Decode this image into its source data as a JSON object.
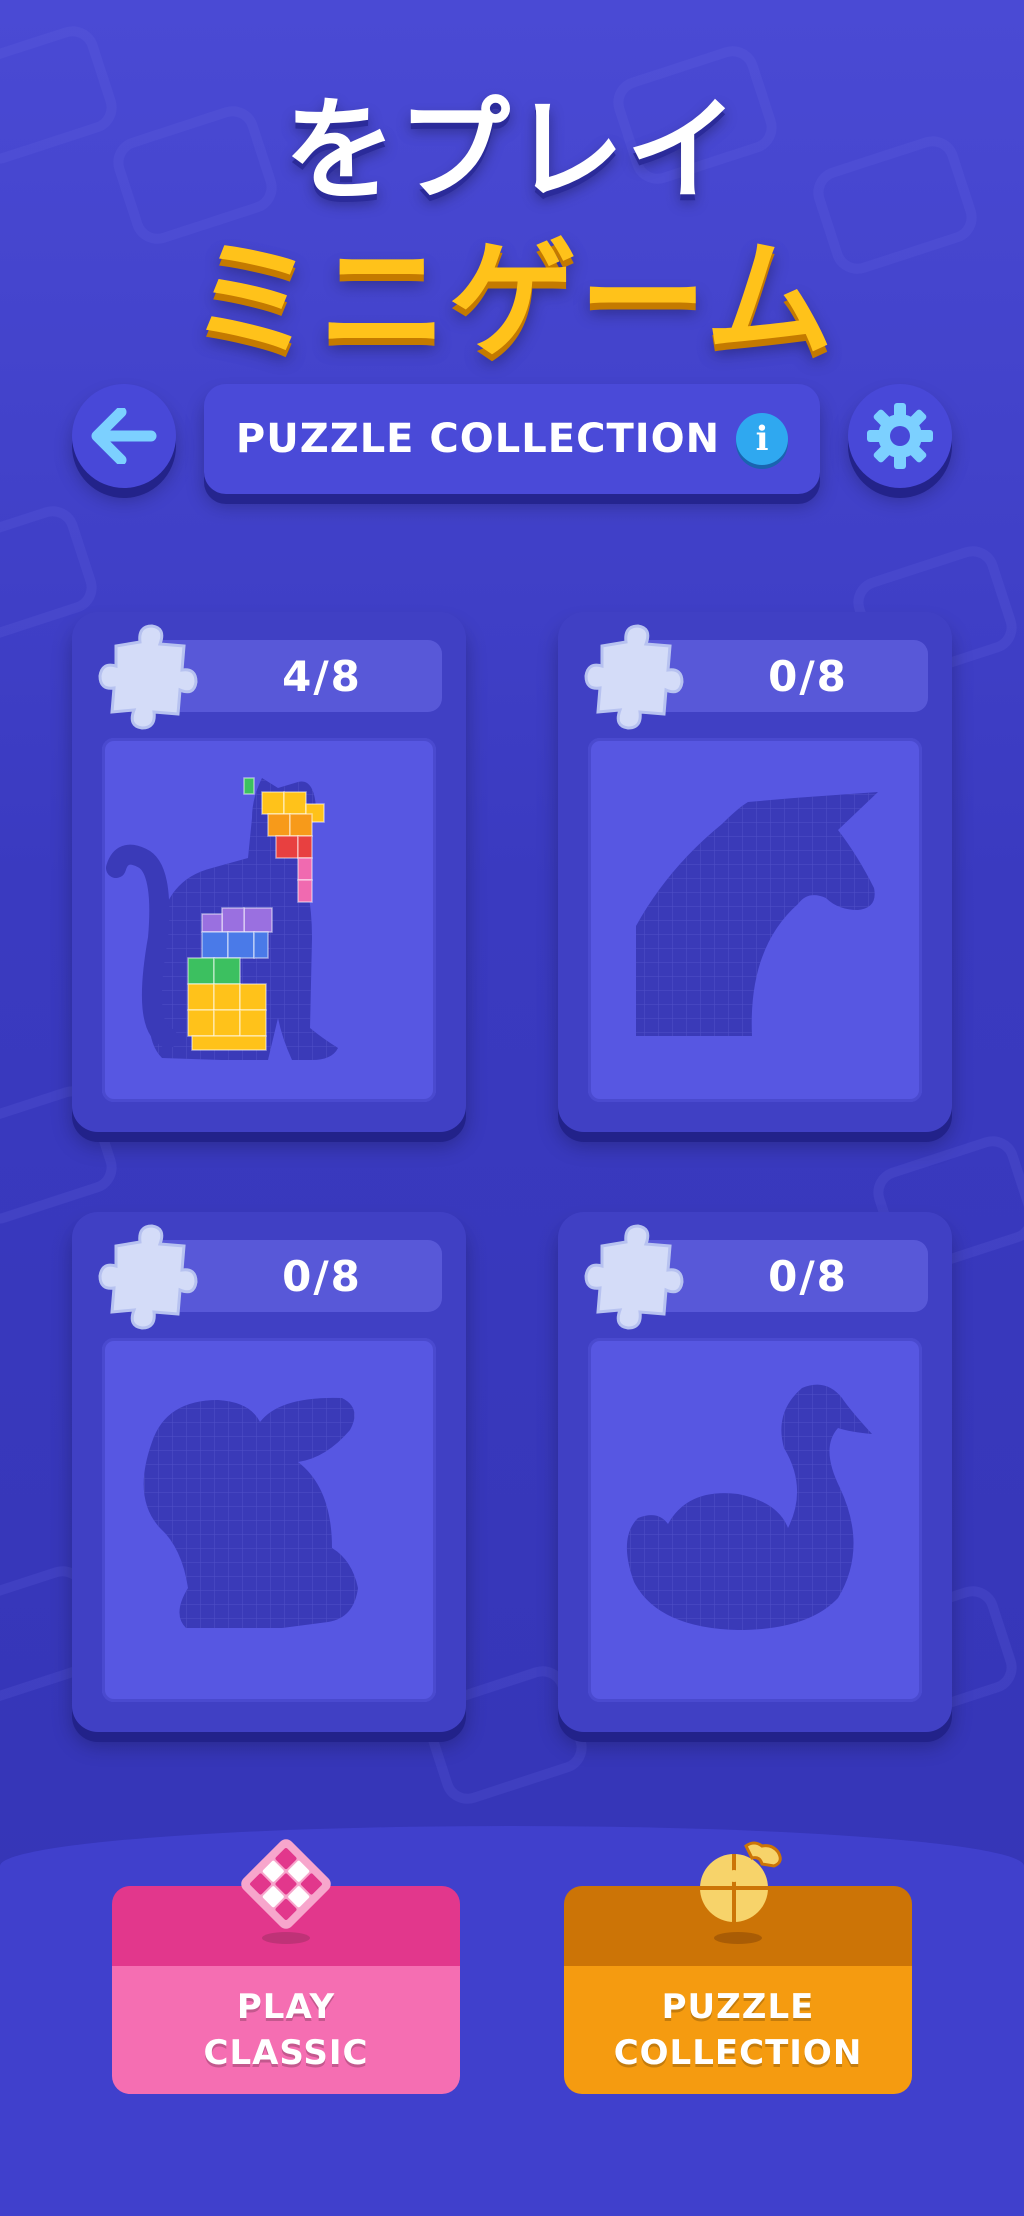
{
  "title": {
    "line1": "をプレイ",
    "line2": "ミニゲーム"
  },
  "header": {
    "back_icon": "back-arrow-icon",
    "label": "PUZZLE COLLECTION",
    "info_icon": "info-icon",
    "settings_icon": "gear-icon"
  },
  "puzzles": [
    {
      "name": "cat",
      "progress": "4/8"
    },
    {
      "name": "unicorn",
      "progress": "0/8"
    },
    {
      "name": "rabbit",
      "progress": "0/8"
    },
    {
      "name": "swan",
      "progress": "0/8"
    }
  ],
  "bottom_buttons": [
    {
      "line1": "PLAY",
      "line2": "CLASSIC",
      "icon": "block-grid-icon",
      "color": "#f06ab0"
    },
    {
      "line1": "PUZZLE",
      "line2": "COLLECTION",
      "icon": "puzzle-pieces-icon",
      "color": "#f59b10"
    }
  ],
  "colors": {
    "background": "#3a3ac0",
    "accent_yellow": "#ffc21a",
    "info_blue": "#2fa8f0"
  }
}
